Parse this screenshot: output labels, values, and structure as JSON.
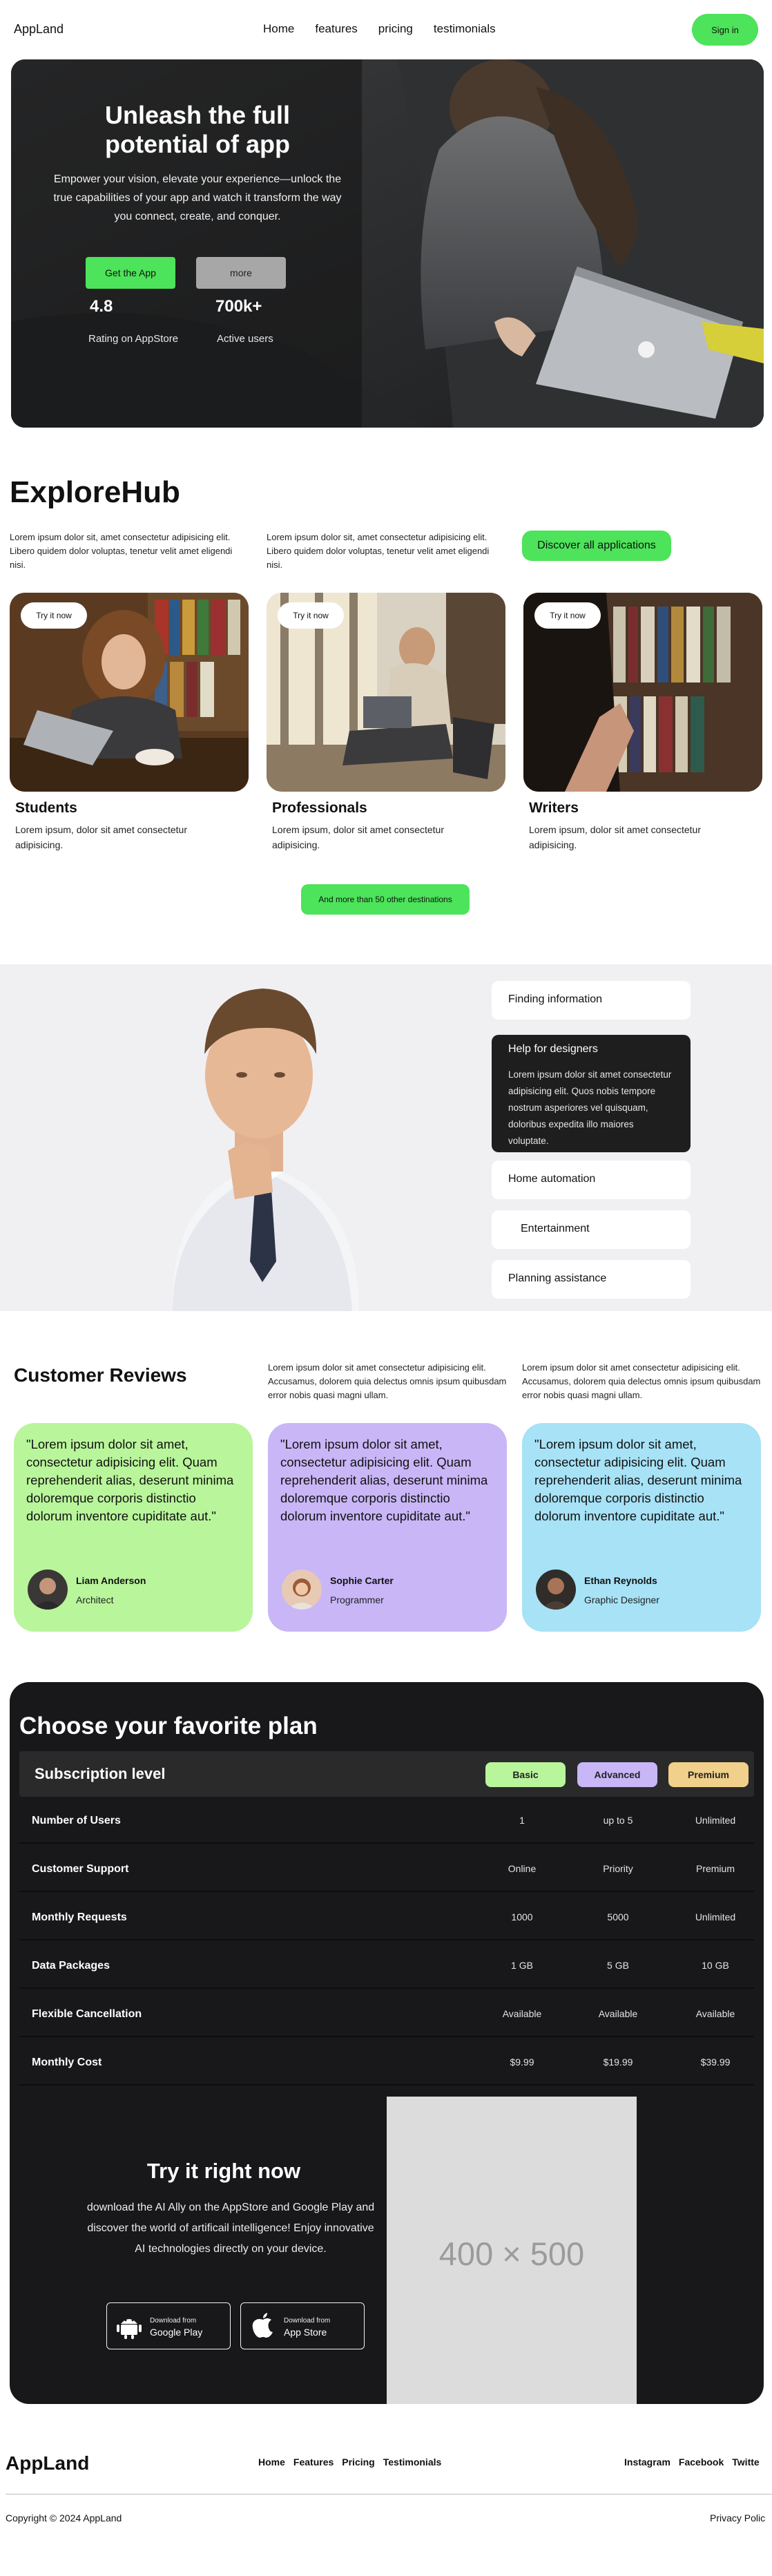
{
  "header": {
    "logo": "AppLand",
    "nav": [
      "Home",
      "features",
      "pricing",
      "testimonials"
    ],
    "signin_label": "Sign in"
  },
  "hero": {
    "title": "Unleash the full potential of app",
    "subtitle": "Empower your vision, elevate your experience—unlock the true capabilities of your app and watch it transform the way you connect, create, and conquer.",
    "get_app_label": "Get the App",
    "more_label": "more",
    "stats": [
      {
        "value": "4.8",
        "label": "Rating on AppStore"
      },
      {
        "value": "700k+",
        "label": "Active users"
      }
    ]
  },
  "explore": {
    "title": "ExploreHub",
    "text1": "Lorem ipsum dolor sit, amet consectetur adipisicing elit. Libero quidem dolor voluptas, tenetur velit amet eligendi nisi.",
    "text2": "Lorem ipsum dolor sit, amet consectetur adipisicing elit. Libero quidem dolor voluptas, tenetur velit amet eligendi nisi.",
    "discover_label": "Discover all applications",
    "cards": [
      {
        "try": "Try it now",
        "title": "Students",
        "desc": "Lorem ipsum, dolor sit amet consectetur adipisicing."
      },
      {
        "try": "Try it now",
        "title": "Professionals",
        "desc": "Lorem ipsum, dolor sit amet consectetur adipisicing."
      },
      {
        "try": "Try it now",
        "title": "Writers",
        "desc": "Lorem ipsum, dolor sit amet consectetur adipisicing."
      }
    ],
    "more_label": "And more than 50 other destinations"
  },
  "features": {
    "items": [
      "Finding information",
      "Help for designers",
      "Home automation",
      "Entertainment",
      "Planning assistance"
    ],
    "active_text": "Lorem ipsum dolor sit amet consectetur adipisicing elit. Quos nobis tempore nostrum asperiores vel quisquam, doloribus expedita illo maiores voluptate."
  },
  "reviews": {
    "title": "Customer Reviews",
    "text1": "Lorem ipsum dolor sit amet consectetur adipisicing elit. Accusamus, dolorem quia delectus omnis ipsum quibusdam error nobis quasi magni ullam.",
    "text2": "Lorem ipsum dolor sit amet consectetur adipisicing elit. Accusamus, dolorem quia delectus omnis ipsum quibusdam error nobis quasi magni ullam.",
    "cards": [
      {
        "quote": "\"Lorem ipsum dolor sit amet, consectetur adipisicing elit. Quam reprehenderit alias, deserunt minima doloremque corporis distinctio dolorum inventore cupiditate aut.\"",
        "name": "Liam Anderson",
        "role": "Architect",
        "color": "#b9f59b"
      },
      {
        "quote": "\"Lorem ipsum dolor sit amet, consectetur adipisicing elit. Quam reprehenderit alias, deserunt minima doloremque corporis distinctio dolorum inventore cupiditate aut.\"",
        "name": "Sophie Carter",
        "role": "Programmer",
        "color": "#c8b6f7"
      },
      {
        "quote": "\"Lorem ipsum dolor sit amet, consectetur adipisicing elit. Quam reprehenderit alias, deserunt minima doloremque corporis distinctio dolorum inventore cupiditate aut.\"",
        "name": "Ethan Reynolds",
        "role": "Graphic Designer",
        "color": "#a7e2f6"
      }
    ]
  },
  "pricing": {
    "title": "Choose your favorite plan",
    "head_label": "Subscription level",
    "plans": [
      {
        "name": "Basic",
        "color": "#b9f59b"
      },
      {
        "name": "Advanced",
        "color": "#c8b6f7"
      },
      {
        "name": "Premium",
        "color": "#f0d08a"
      }
    ],
    "rows": [
      {
        "label": "Number of Users",
        "values": [
          "1",
          "up to 5",
          "Unlimited"
        ]
      },
      {
        "label": "Customer Support",
        "values": [
          "Online",
          "Priority",
          "Premium"
        ]
      },
      {
        "label": "Monthly Requests",
        "values": [
          "1000",
          "5000",
          "Unlimited"
        ]
      },
      {
        "label": "Data Packages",
        "values": [
          "1 GB",
          "5 GB",
          "10 GB"
        ]
      },
      {
        "label": "Flexible Cancellation",
        "values": [
          "Available",
          "Available",
          "Available"
        ]
      },
      {
        "label": "Monthly Cost",
        "values": [
          "$9.99",
          "$19.99",
          "$39.99"
        ]
      }
    ]
  },
  "try": {
    "title": "Try it right now",
    "subtitle": "download the AI Ally on the AppStore and Google Play and discover the world of artificail intelligence! Enjoy innovative AI technologies directly on your device.",
    "google_small": "Download from",
    "google_big": "Google Play",
    "apple_small": "Download from",
    "apple_big": "App Store",
    "placeholder": "400 × 500"
  },
  "footer": {
    "logo": "AppLand",
    "nav": [
      "Home",
      "Features",
      "Pricing",
      "Testimonials"
    ],
    "social": [
      "Instagram",
      "Facebook",
      "Twitte"
    ],
    "copyright": "Copyright © 2024 AppLand",
    "privacy": "Privacy Polic"
  }
}
